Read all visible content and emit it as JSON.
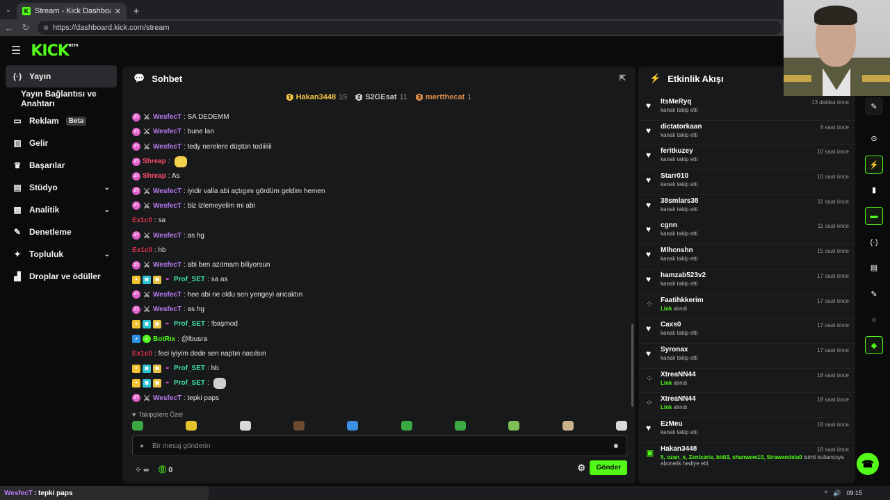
{
  "browser": {
    "tab_title": "Stream - Kick Dashboard",
    "tab_favicon": "K",
    "url": "https://dashboard.kick.com/stream"
  },
  "header": {
    "logo": "KICK",
    "logo_tag": "BETA"
  },
  "sidebar": {
    "items": [
      {
        "label": "Yayın",
        "icon": "broadcast-icon",
        "glyph": "(·)",
        "active": true
      },
      {
        "label": "Yayın Bağlantısı ve Anahtarı",
        "icon": "",
        "glyph": ""
      },
      {
        "label": "Reklam",
        "icon": "ads-icon",
        "glyph": "▭",
        "badge": "Beta"
      },
      {
        "label": "Gelir",
        "icon": "revenue-icon",
        "glyph": "▥"
      },
      {
        "label": "Başarılar",
        "icon": "trophy-icon",
        "glyph": "♛"
      },
      {
        "label": "Stüdyo",
        "icon": "studio-icon",
        "glyph": "▤",
        "chevron": true
      },
      {
        "label": "Analitik",
        "icon": "analytics-icon",
        "glyph": "▦",
        "chevron": true
      },
      {
        "label": "Denetleme",
        "icon": "wrench-icon",
        "glyph": "✎"
      },
      {
        "label": "Topluluk",
        "icon": "community-icon",
        "glyph": "✦",
        "chevron": true
      },
      {
        "label": "Droplar ve ödüller",
        "icon": "drops-icon",
        "glyph": "▟"
      }
    ]
  },
  "chat": {
    "title": "Sohbet",
    "leaders": [
      {
        "name": "Hakan3448",
        "count": "15",
        "color": "#f5c542",
        "rank": "1"
      },
      {
        "name": "S2GEsat",
        "count": "11",
        "color": "#c9c9c9",
        "rank": "2"
      },
      {
        "name": "mertthecat",
        "count": "1",
        "color": "#d98b4a",
        "rank": "3"
      }
    ],
    "messages": [
      {
        "user": "WesfecT",
        "color": "#b77cf2",
        "badges": [
          "sub",
          "sw"
        ],
        "text": ": SA DEDEMM"
      },
      {
        "user": "WesfecT",
        "color": "#b77cf2",
        "badges": [
          "sub",
          "sw"
        ],
        "text": ": bune lan"
      },
      {
        "user": "WesfecT",
        "color": "#b77cf2",
        "badges": [
          "sub",
          "sw"
        ],
        "text": ": tedy nerelere düştün todiiiiii"
      },
      {
        "user": "Shreap",
        "color": "#ff4d6a",
        "badges": [
          "sub"
        ],
        "text": ":",
        "emote": "#f2d14b"
      },
      {
        "user": "Shreap",
        "color": "#ff4d6a",
        "badges": [
          "sub"
        ],
        "text": ": As"
      },
      {
        "user": "WesfecT",
        "color": "#b77cf2",
        "badges": [
          "sub",
          "sw"
        ],
        "text": ": iyidir valla abi açtıgını gördüm geldim hemen"
      },
      {
        "user": "WesfecT",
        "color": "#b77cf2",
        "badges": [
          "sub",
          "sw"
        ],
        "text": ": biz izlemeyelim mi abi"
      },
      {
        "user": "Ex1c0",
        "color": "#e0304e",
        "badges": [],
        "text": ": sa"
      },
      {
        "user": "WesfecT",
        "color": "#b77cf2",
        "badges": [
          "sub",
          "sw"
        ],
        "text": ": as hg"
      },
      {
        "user": "Ex1c0",
        "color": "#e0304e",
        "badges": [],
        "text": ": hb"
      },
      {
        "user": "WesfecT",
        "color": "#b77cf2",
        "badges": [
          "sub",
          "sw"
        ],
        "text": ": abi ben azıtmam biliyorsun"
      },
      {
        "user": "Prof_SET",
        "color": "#3fe0a6",
        "badges": [
          "og",
          "vip",
          "gift",
          "pen"
        ],
        "text": ": sa as"
      },
      {
        "user": "WesfecT",
        "color": "#b77cf2",
        "badges": [
          "sub",
          "sw"
        ],
        "text": ": hee abi ne oldu sen yengeyi arıcaktın"
      },
      {
        "user": "WesfecT",
        "color": "#b77cf2",
        "badges": [
          "sub",
          "sw"
        ],
        "text": ": as hg"
      },
      {
        "user": "Prof_SET",
        "color": "#3fe0a6",
        "badges": [
          "og",
          "vip",
          "gift",
          "pen"
        ],
        "text": ": !başmod"
      },
      {
        "user": "BotRix",
        "color": "#53fc18",
        "badges": [
          "bot",
          "verified"
        ],
        "text": ": @lbusra"
      },
      {
        "user": "Ex1c0",
        "color": "#e0304e",
        "badges": [],
        "text": ": feci iyiyim dede sen naptın nasılsın"
      },
      {
        "user": "Prof_SET",
        "color": "#3fe0a6",
        "badges": [
          "og",
          "vip",
          "gift",
          "pen"
        ],
        "text": ": hb"
      },
      {
        "user": "Prof_SET",
        "color": "#3fe0a6",
        "badges": [
          "og",
          "vip",
          "gift",
          "pen"
        ],
        "text": ":",
        "emote": "#cfcfcf"
      },
      {
        "user": "WesfecT",
        "color": "#b77cf2",
        "badges": [
          "sub",
          "sw"
        ],
        "text": ": tepki paps"
      }
    ],
    "emote_section": "Takipçilere Özel",
    "emote_colors": [
      "#3aa843",
      "#e6c22e",
      "#d9d9d9",
      "#6b4a2e",
      "#3a8fe0",
      "#3aa843",
      "#3aa843",
      "#7fbf5a",
      "#c9b28a",
      "#d9d9d9"
    ],
    "input_placeholder": "Bir mesaj gönderin",
    "viewers": "∞",
    "points": "0",
    "send_label": "Gönder"
  },
  "activity": {
    "title": "Etkinlik Akışı",
    "items": [
      {
        "user": "ItsMeRyq",
        "desc": "kanalı takip etti",
        "time": "13 dakika önce",
        "type": "follow"
      },
      {
        "user": "dictatorkaan",
        "desc": "kanalı takip etti",
        "time": "8 saat önce",
        "type": "follow"
      },
      {
        "user": "feritkuzey",
        "desc": "kanalı takip etti",
        "time": "10 saat önce",
        "type": "follow"
      },
      {
        "user": "Starr010",
        "desc": "kanalı takip etti",
        "time": "10 saat önce",
        "type": "follow"
      },
      {
        "user": "38smlars38",
        "desc": "kanalı takip etti",
        "time": "11 saat önce",
        "type": "follow"
      },
      {
        "user": "cgnn",
        "desc": "kanalı takip etti",
        "time": "11 saat önce",
        "type": "follow"
      },
      {
        "user": "Mlhcnshn",
        "desc": "kanalı takip etti",
        "time": "15 saat önce",
        "type": "follow"
      },
      {
        "user": "hamzab523v2",
        "desc": "kanalı takip etti",
        "time": "17 saat önce",
        "type": "follow"
      },
      {
        "user": "Faatihkkerim",
        "link": "Link",
        "desc": " alındı",
        "time": "17 saat önce",
        "type": "link"
      },
      {
        "user": "Caxs0",
        "desc": "kanalı takip etti",
        "time": "17 saat önce",
        "type": "follow"
      },
      {
        "user": "Syronax",
        "desc": "kanalı takip etti",
        "time": "17 saat önce",
        "type": "follow"
      },
      {
        "user": "XtreaNN44",
        "link": "Link",
        "desc": " alındı",
        "time": "18 saat önce",
        "type": "link"
      },
      {
        "user": "XtreaNN44",
        "link": "Link",
        "desc": " alındı",
        "time": "18 saat önce",
        "type": "link"
      },
      {
        "user": "EzMeu",
        "desc": "kanalı takip etti",
        "time": "18 saat önce",
        "type": "follow"
      },
      {
        "user": "Hakan3448",
        "link": "5, ozan_e, Zenixaris, bidi3, shanwow10, Sirawendela0",
        "desc": " isimli kullanıcıya abonelik hediye etti.",
        "time": "18 saat önce",
        "type": "gift"
      }
    ]
  },
  "taskbar": {
    "chat_user": "WesfecT",
    "chat_text": ": tepki paps",
    "clock": "09:15"
  },
  "colors": {
    "accent": "#53fc18"
  }
}
